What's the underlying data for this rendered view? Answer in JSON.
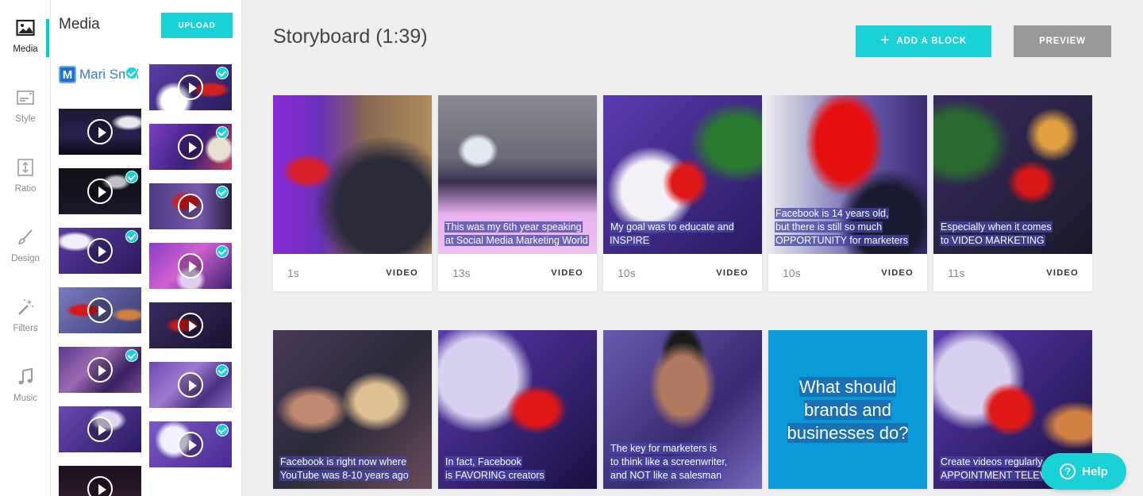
{
  "rail": {
    "items": [
      {
        "label": "Media",
        "icon": "image-icon"
      },
      {
        "label": "Style",
        "icon": "style-icon"
      },
      {
        "label": "Ratio",
        "icon": "ratio-icon"
      },
      {
        "label": "Design",
        "icon": "brush-icon"
      },
      {
        "label": "Filters",
        "icon": "magic-wand-icon"
      },
      {
        "label": "Music",
        "icon": "music-note-icon"
      }
    ]
  },
  "panel": {
    "title": "Media",
    "upload_label": "UPLOAD",
    "logo": {
      "letter": "M",
      "text": "Mari Smith"
    }
  },
  "main": {
    "title": "Storyboard (1:39)",
    "add_block_label": "ADD A BLOCK",
    "preview_label": "PREVIEW",
    "help_label": "Help",
    "help_glyph": "?",
    "cards": [
      {
        "duration": "1s",
        "type": "VIDEO",
        "caption": []
      },
      {
        "duration": "13s",
        "type": "VIDEO",
        "caption": [
          "This was my 6th year speaking",
          "at Social Media Marketing World"
        ]
      },
      {
        "duration": "10s",
        "type": "VIDEO",
        "caption": [
          "My goal was to educate and INSPIRE"
        ]
      },
      {
        "duration": "10s",
        "type": "VIDEO",
        "caption": [
          "Facebook is 14 years old,",
          "but there is still so much",
          "OPPORTUNITY for marketers"
        ]
      },
      {
        "duration": "11s",
        "type": "VIDEO",
        "caption": [
          "Especially when it comes",
          "to VIDEO MARKETING"
        ]
      },
      {
        "caption": [
          "Facebook is right now where",
          "YouTube was 8-10 years ago"
        ]
      },
      {
        "caption": [
          "In fact, Facebook",
          "is FAVORING creators"
        ]
      },
      {
        "caption": [
          "The key for marketers is",
          "to think like a screenwriter,",
          "and NOT like a salesman"
        ]
      },
      {
        "big_text": [
          "What should",
          "brands and",
          "businesses do?"
        ]
      },
      {
        "caption": [
          "Create videos regularly",
          "APPOINTMENT TELEVIS"
        ]
      }
    ]
  },
  "colors": {
    "accent": "#19d1d6",
    "preview": "#999999",
    "caption_bg": "#4646aa"
  }
}
